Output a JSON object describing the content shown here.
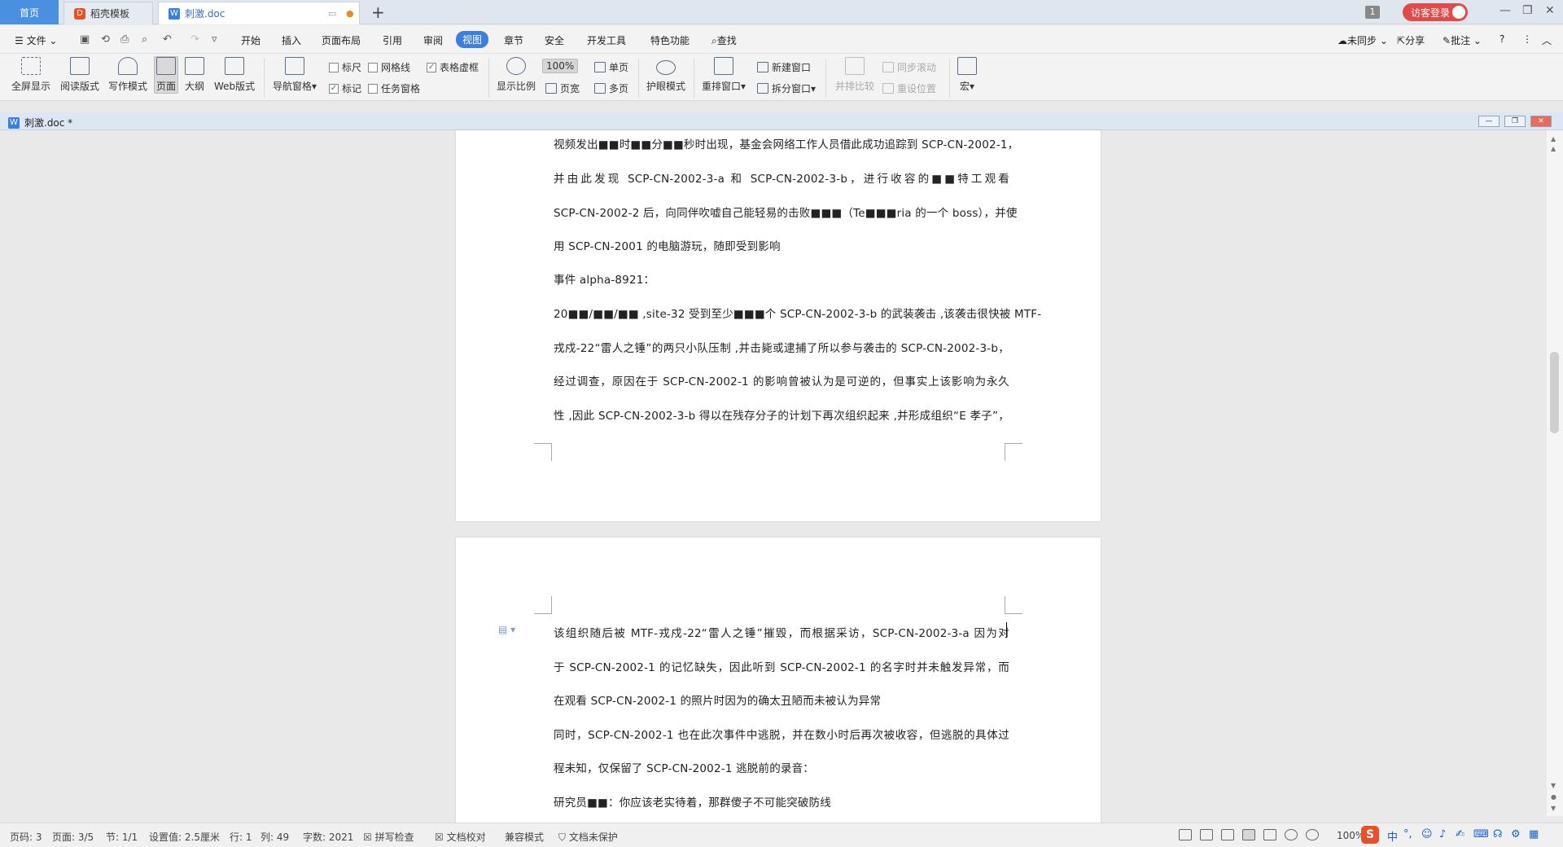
{
  "tabs": {
    "home": "首页",
    "docer": "稻壳模板",
    "doc": "刺激.doc"
  },
  "topright": {
    "badge": "1",
    "guest_login": "访客登录"
  },
  "menu": {
    "file": "文件",
    "items": [
      "开始",
      "插入",
      "页面布局",
      "引用",
      "审阅",
      "视图",
      "章节",
      "安全",
      "开发工具",
      "特色功能"
    ],
    "active": "视图",
    "search": "查找",
    "sync": "未同步",
    "share": "分享",
    "comment": "批注",
    "help": "?"
  },
  "ribbon": {
    "fullscreen": "全屏显示",
    "reading": "阅读版式",
    "writing": "写作模式",
    "page": "页面",
    "outline": "大纲",
    "web": "Web版式",
    "nav_pane": "导航窗格",
    "ruler": "标尺",
    "gridlines": "网格线",
    "table_gridlines": "表格虚框",
    "marks": "标记",
    "task_pane": "任务窗格",
    "zoom_ratio": "显示比例",
    "zoom_100": "100%",
    "single_page": "单页",
    "page_width": "页宽",
    "multi_page": "多页",
    "eye_mode": "护眼模式",
    "rearrange": "重排窗口",
    "new_window": "新建窗口",
    "split_window": "拆分窗口",
    "side_by_side": "并排比较",
    "sync_scroll": "同步滚动",
    "reset_position": "重设位置",
    "macro": "宏"
  },
  "docwindow": {
    "title": "刺激.doc *"
  },
  "page1_lines": [
    "视频发出■■时■■分■■秒时出现，基金会网络工作人员借此成功追踪到 SCP-CN-2002-1，",
    "并由此发现 SCP-CN-2002-3-a 和 SCP-CN-2002-3-b，进行收容的■■特工观看",
    "SCP-CN-2002-2 后，向同伴吹嘘自己能轻易的击败■■■（Te■■■ria 的一个 boss），并使",
    "用 SCP-CN-2001 的电脑游玩，随即受到影响",
    "事件 alpha-8921：",
    "20■■/■■/■■ ,site-32 受到至少■■■个 SCP-CN-2002-3-b 的武装袭击 ,该袭击很快被 MTF-",
    "戎戍-22“雷人之锤”的两只小队压制 ,并击毙或逮捕了所以参与袭击的 SCP-CN-2002-3-b，",
    "经过调查，原因在于 SCP-CN-2002-1 的影响曾被认为是可逆的，但事实上该影响为永久",
    "性 ,因此 SCP-CN-2002-3-b 得以在残存分子的计划下再次组织起来 ,并形成组织“E 孝子”，"
  ],
  "page2_lines": [
    "该组织随后被 MTF-戎戍-22“雷人之锤”摧毁，而根据采访，SCP-CN-2002-3-a 因为对",
    "于 SCP-CN-2002-1 的记忆缺失，因此听到 SCP-CN-2002-1 的名字时并未触发异常，而",
    "在观看 SCP-CN-2002-1 的照片时因为的确太丑陋而未被认为异常",
    "同时，SCP-CN-2002-1 也在此次事件中逃脱，并在数小时后再次被收容，但逃脱的具体过",
    "程未知，仅保留了 SCP-CN-2002-1 逃脱前的录音：",
    "研究员■■：你应该老实待着，那群傻子不可能突破防线"
  ],
  "status": {
    "page_num": "页码: 3",
    "pages": "页面: 3/5",
    "section": "节: 1/1",
    "setting": "设置值: 2.5厘米",
    "row": "行: 1",
    "col": "列: 49",
    "words": "字数: 2021",
    "spell": "拼写检查",
    "proof": "文档校对",
    "compat": "兼容模式",
    "protect": "文档未保护",
    "zoom": "100%"
  },
  "ime": {
    "lang": "中"
  }
}
